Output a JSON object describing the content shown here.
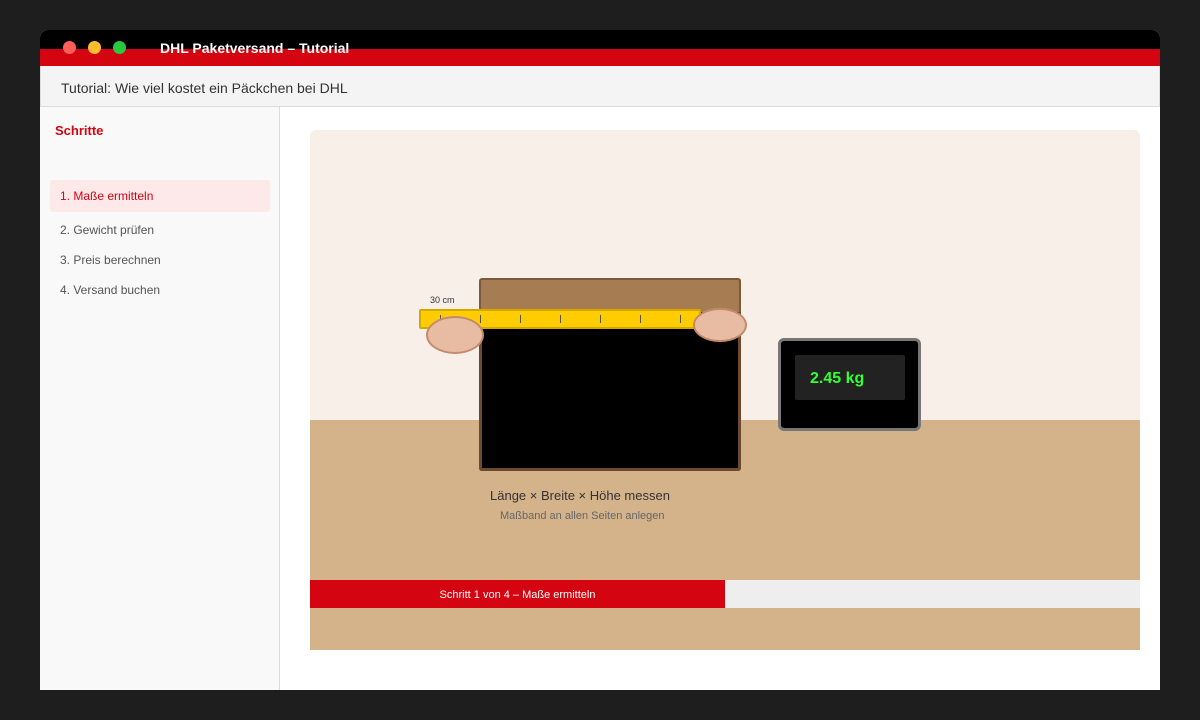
{
  "window": {
    "title": "DHL Paketversand – Tutorial"
  },
  "header": {
    "text": "Tutorial: Wie viel kostet ein Päckchen bei DHL"
  },
  "sidebar": {
    "heading": "Schritte",
    "items": [
      {
        "label": "1. Maße ermitteln",
        "active": true
      },
      {
        "label": "2. Gewicht prüfen",
        "active": false
      },
      {
        "label": "3. Preis berechnen",
        "active": false
      },
      {
        "label": "4. Versand buchen",
        "active": false
      }
    ]
  },
  "scene": {
    "tape_label": "30 cm",
    "scale_reading": "2.45 kg",
    "caption": "Länge × Breite × Höhe messen",
    "subcaption": "Maßband an allen Seiten anlegen"
  },
  "progress": {
    "text": "Schritt 1 von 4 – Maße ermitteln",
    "fraction": 0.5
  },
  "colors": {
    "brand_red": "#d40511",
    "brand_yellow": "#ffcc00",
    "display_green": "#33ff33"
  }
}
